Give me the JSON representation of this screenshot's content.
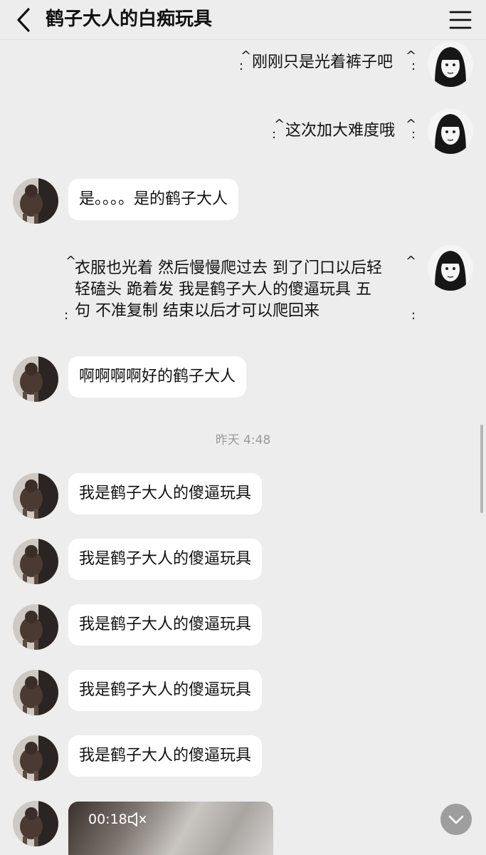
{
  "header": {
    "title": "鹤子大人的白痴玩具",
    "back_icon": "chevron-left-icon",
    "menu_icon": "hamburger-menu-icon"
  },
  "messages": [
    {
      "side": "right",
      "text": "刚刚只是光着裤子吧"
    },
    {
      "side": "right",
      "text": "这次加大难度哦"
    },
    {
      "side": "left",
      "text": "是。。。。是的鹤子大人"
    },
    {
      "side": "right",
      "lines": [
        "衣服也光着 然后慢慢爬过去 到了门口以后轻",
        "轻磕头 跪着发 我是鹤子大人的傻逼玩具 五",
        "句 不准复制 结束以后才可以爬回来"
      ]
    },
    {
      "side": "left",
      "text": "啊啊啊啊好的鹤子大人"
    },
    {
      "side": "left",
      "text": "我是鹤子大人的傻逼玩具"
    },
    {
      "side": "left",
      "text": "我是鹤子大人的傻逼玩具"
    },
    {
      "side": "left",
      "text": "我是鹤子大人的傻逼玩具"
    },
    {
      "side": "left",
      "text": "我是鹤子大人的傻逼玩具"
    },
    {
      "side": "left",
      "text": "我是鹤子大人的傻逼玩具"
    }
  ],
  "timestamp": "昨天 4:48",
  "video": {
    "duration": "00:18",
    "muted_icon": "speaker-muted-icon"
  },
  "scroll_down_icon": "chevron-down-icon",
  "deco": {
    "caret": "^",
    "dot": ":"
  },
  "colors": {
    "background": "#ededed",
    "bubble": "#ffffff",
    "timestamp": "#9a9a9a"
  }
}
